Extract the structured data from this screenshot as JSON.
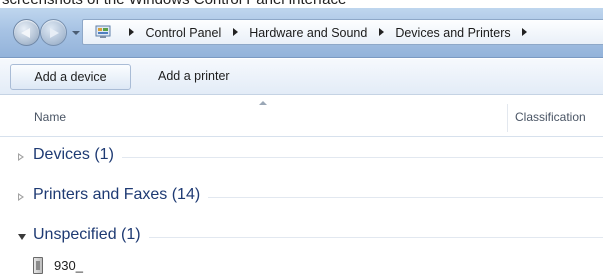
{
  "top_caption": "screenshots of the Windows Control Panel interface",
  "address_bar": {
    "breadcrumbs": [
      "Control Panel",
      "Hardware and Sound",
      "Devices and Printers"
    ]
  },
  "toolbar": {
    "add_device_label": "Add a device",
    "add_printer_label": "Add a printer"
  },
  "columns": {
    "name": "Name",
    "classification": "Classification"
  },
  "groups": [
    {
      "label": "Devices (1)",
      "state": "collapsed"
    },
    {
      "label": "Printers and Faxes (14)",
      "state": "collapsed"
    },
    {
      "label": "Unspecified (1)",
      "state": "expanded"
    }
  ],
  "items": [
    {
      "label": "930_",
      "icon": "device-icon"
    }
  ],
  "colors": {
    "group_text": "#1e3a73",
    "addressbar": "#a7c3e4",
    "toolbar": "#e3ecf7"
  }
}
